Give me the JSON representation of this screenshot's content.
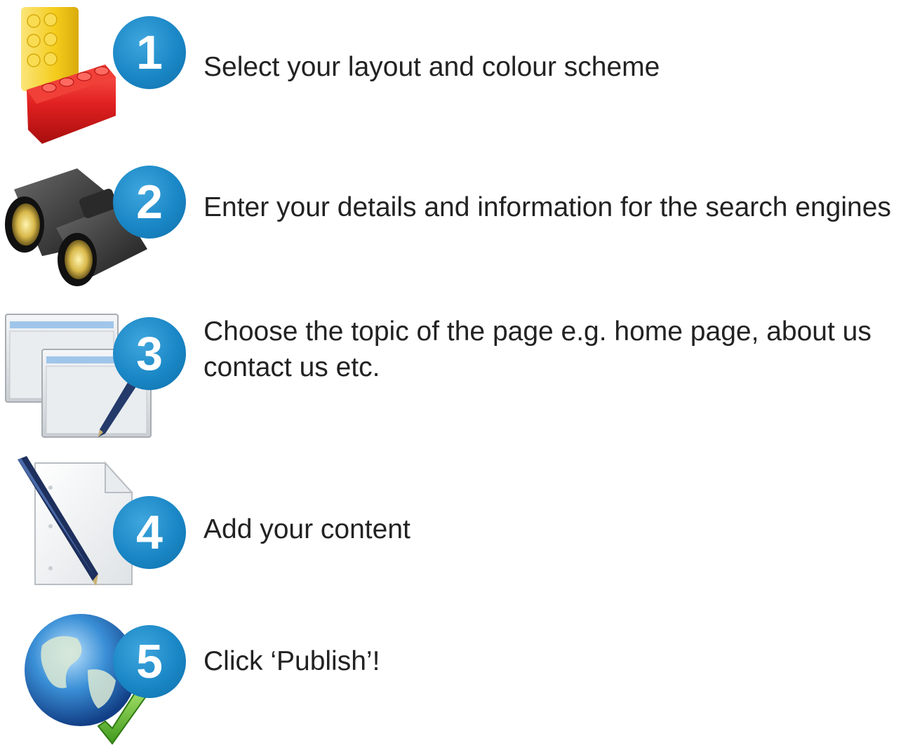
{
  "steps": [
    {
      "number": "1",
      "text": "Select your layout and colour scheme",
      "icon": "lego-bricks-icon"
    },
    {
      "number": "2",
      "text": "Enter your details and information for the search engines",
      "icon": "binoculars-icon"
    },
    {
      "number": "3",
      "text": "Choose the topic of the page e.g. home page, about us contact us etc.",
      "icon": "windows-pen-icon"
    },
    {
      "number": "4",
      "text": "Add your content",
      "icon": "document-pen-icon"
    },
    {
      "number": "5",
      "text": "Click ‘Publish’!",
      "icon": "globe-check-icon"
    }
  ],
  "colors": {
    "badge": "#1a87c6",
    "text": "#222222",
    "lego_red": "#e02020",
    "lego_yellow": "#f4cc1c",
    "check_green": "#5cb82c"
  }
}
